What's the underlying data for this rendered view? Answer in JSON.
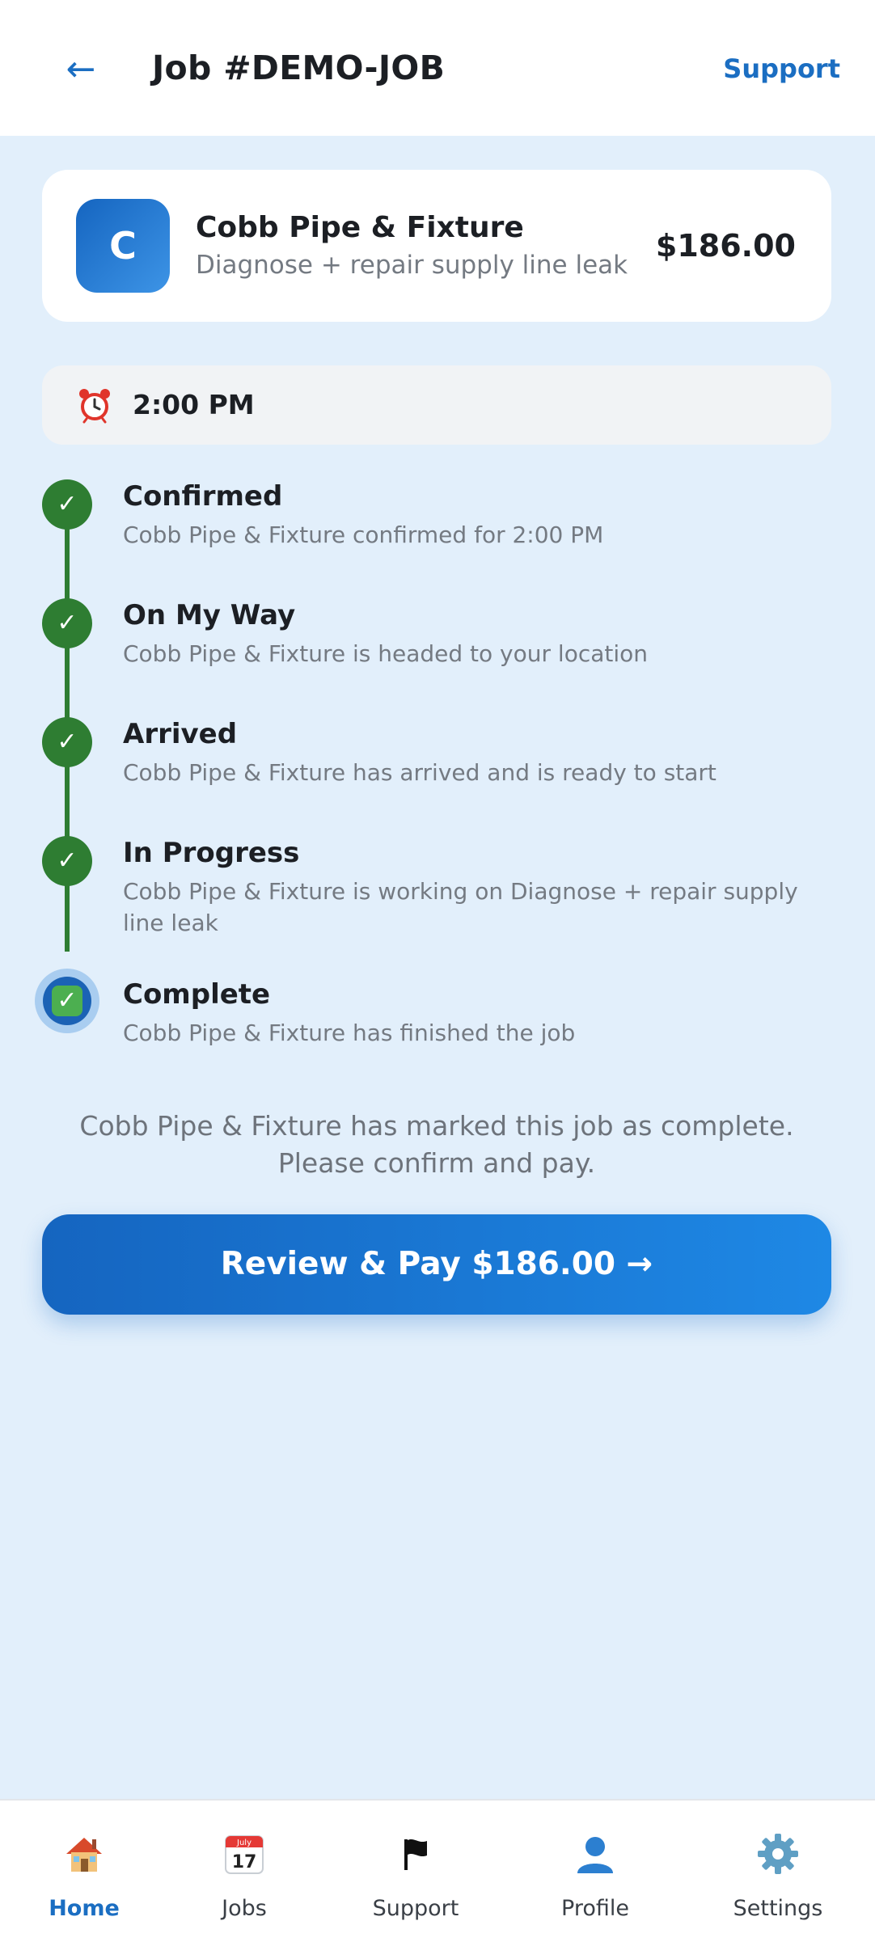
{
  "header": {
    "back_icon": "back-arrow-icon",
    "title": "Job #DEMO-JOB",
    "support_label": "Support"
  },
  "provider": {
    "avatar_letter": "C",
    "name": "Cobb Pipe & Fixture",
    "service": "Diagnose + repair supply line leak",
    "price": "$186.00"
  },
  "schedule": {
    "icon": "alarm-clock-icon",
    "time": "2:00 PM"
  },
  "timeline": [
    {
      "title": "Confirmed",
      "desc": "Cobb Pipe & Fixture confirmed for 2:00 PM",
      "state": "done"
    },
    {
      "title": "On My Way",
      "desc": "Cobb Pipe & Fixture is headed to your location",
      "state": "done"
    },
    {
      "title": "Arrived",
      "desc": "Cobb Pipe & Fixture has arrived and is ready to start",
      "state": "done"
    },
    {
      "title": "In Progress",
      "desc": "Cobb Pipe & Fixture is working on Diagnose + repair supply line leak",
      "state": "done"
    },
    {
      "title": "Complete",
      "desc": "Cobb Pipe & Fixture has finished the job",
      "state": "current"
    }
  ],
  "completion_message": "Cobb Pipe & Fixture has marked this job as complete. Please confirm and pay.",
  "pay_button_label": "Review & Pay $186.00 →",
  "colors": {
    "brand_blue": "#1b6ec2",
    "status_green": "#2e7d32",
    "background": "#e2effb"
  },
  "bottom_nav": [
    {
      "label": "Home",
      "icon": "house-icon",
      "active": true
    },
    {
      "label": "Jobs",
      "icon": "calendar-icon",
      "active": false
    },
    {
      "label": "Support",
      "icon": "flag-icon",
      "active": false
    },
    {
      "label": "Profile",
      "icon": "person-icon",
      "active": false
    },
    {
      "label": "Settings",
      "icon": "gear-icon",
      "active": false
    }
  ]
}
